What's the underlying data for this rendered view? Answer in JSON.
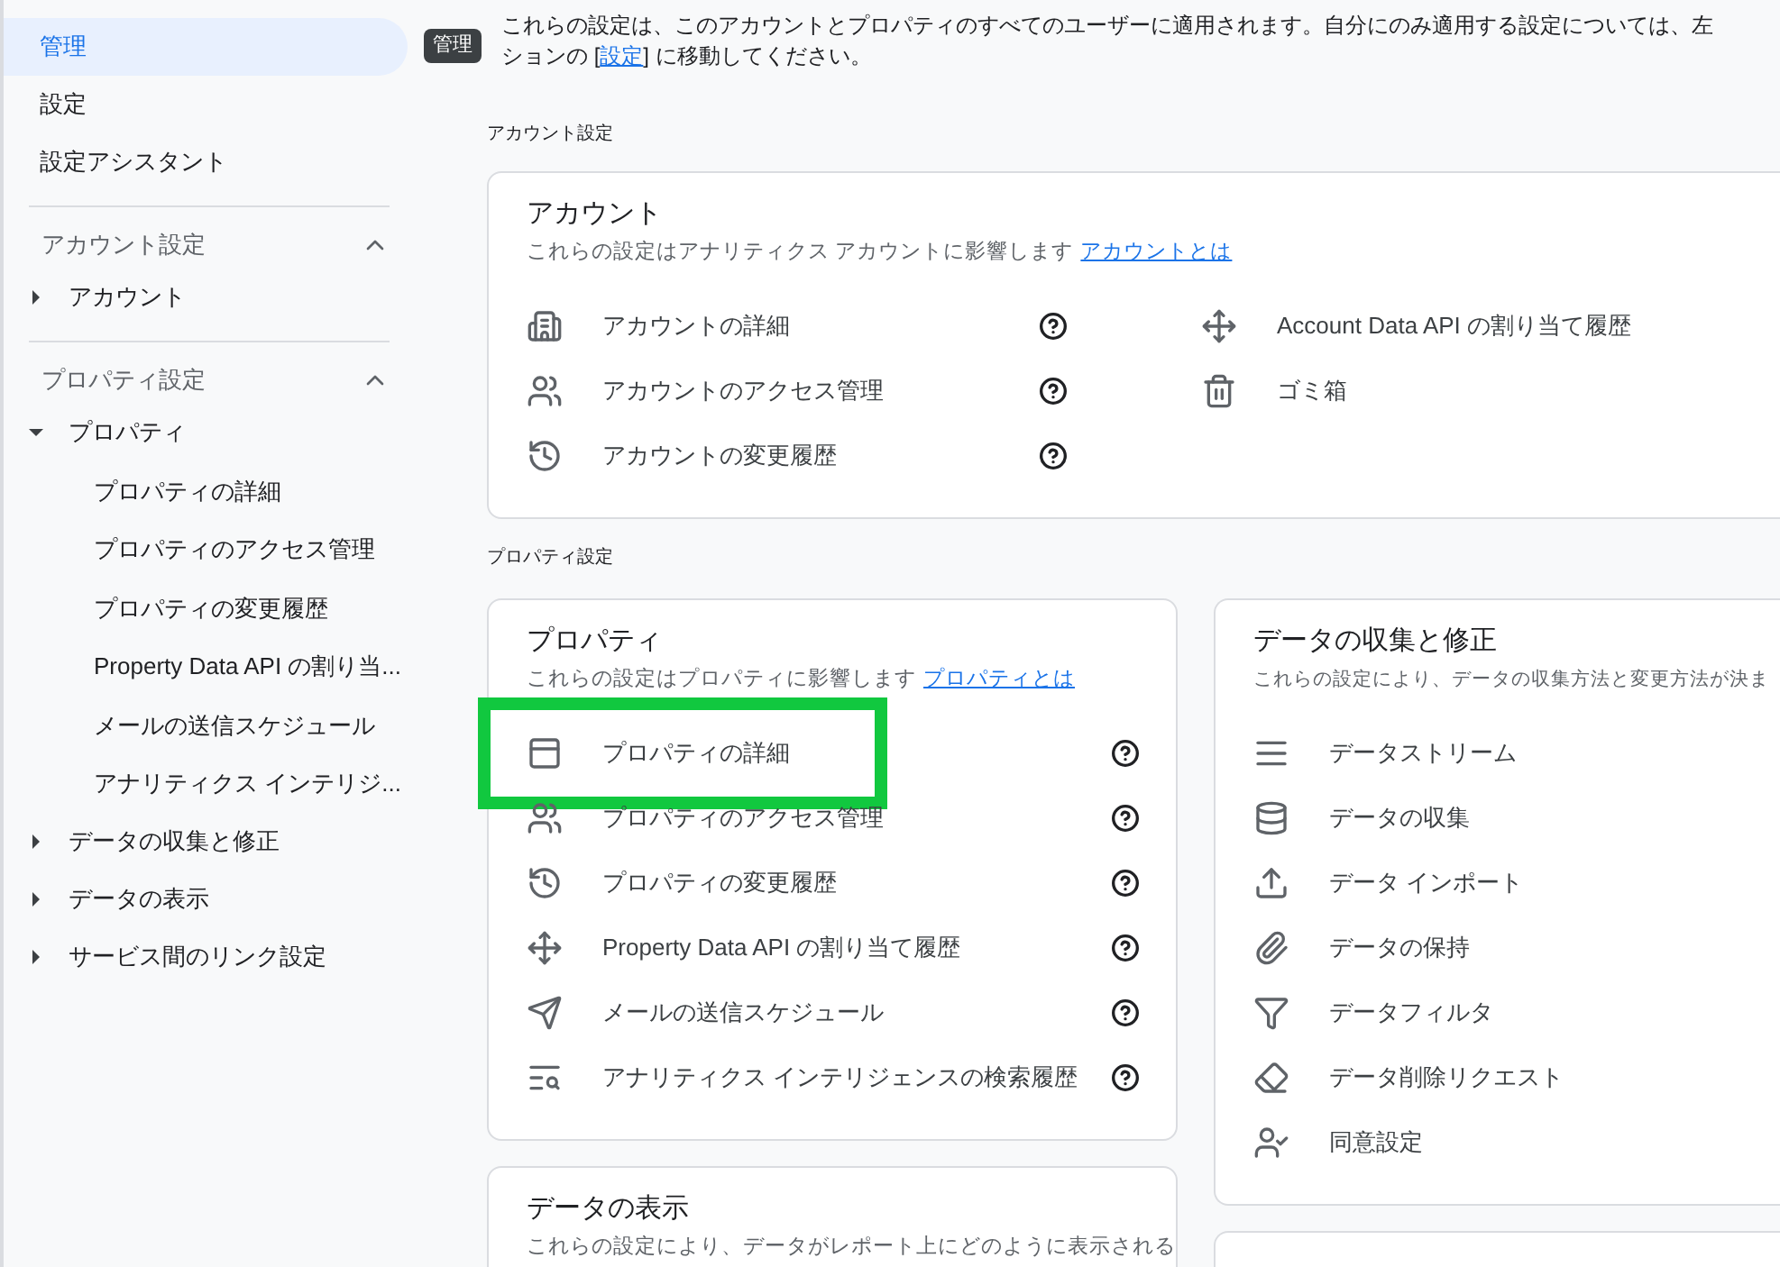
{
  "sidebar": {
    "items": [
      {
        "label": "管理",
        "selected": true,
        "tooltip": "管理"
      },
      {
        "label": "設定",
        "selected": false
      },
      {
        "label": "設定アシスタント",
        "selected": false
      }
    ],
    "sections": [
      {
        "title": "アカウント設定",
        "expanded": true,
        "items": [
          {
            "label": "アカウント",
            "expanded": false
          }
        ]
      },
      {
        "title": "プロパティ設定",
        "expanded": true,
        "items": [
          {
            "label": "プロパティ",
            "expanded": true,
            "children": [
              {
                "label": "プロパティの詳細"
              },
              {
                "label": "プロパティのアクセス管理"
              },
              {
                "label": "プロパティの変更履歴"
              },
              {
                "label": "Property Data API の割り当..."
              },
              {
                "label": "メールの送信スケジュール"
              },
              {
                "label": "アナリティクス インテリジ..."
              }
            ]
          },
          {
            "label": "データの収集と修正",
            "expanded": false
          },
          {
            "label": "データの表示",
            "expanded": false
          },
          {
            "label": "サービス間のリンク設定",
            "expanded": false
          }
        ]
      }
    ]
  },
  "notice": {
    "line_1": "これらの設定は、このアカウントとプロパティのすべてのユーザーに適用されます。自分にのみ適用する設定については、左",
    "before_link": "ションの [",
    "link": "設定",
    "after_link": "] に移動してください。"
  },
  "groups": [
    {
      "label": "アカウント設定",
      "cards": [
        {
          "title": "アカウント",
          "description": "これらの設定はアナリティクス アカウントに影響します",
          "link": "アカウントとは",
          "columns": [
            [
              {
                "label": "アカウントの詳細",
                "help": true
              },
              {
                "label": "アカウントのアクセス管理",
                "help": true
              },
              {
                "label": "アカウントの変更履歴",
                "help": true
              }
            ],
            [
              {
                "label": "Account Data API の割り当て履歴",
                "help": false
              },
              {
                "label": "ゴミ箱",
                "help": false
              }
            ]
          ]
        }
      ]
    },
    {
      "label": "プロパティ設定",
      "cards": [
        {
          "title": "プロパティ",
          "description": "これらの設定はプロパティに影響します",
          "link": "プロパティとは",
          "columns": [
            [
              {
                "label": "プロパティの詳細",
                "help": true,
                "highlighted": true
              },
              {
                "label": "プロパティのアクセス管理",
                "help": true,
                "highlighted": false
              },
              {
                "label": "プロパティの変更履歴",
                "help": true,
                "highlighted": false
              },
              {
                "label": "Property Data API の割り当て履歴",
                "help": true,
                "highlighted": false
              },
              {
                "label": "メールの送信スケジュール",
                "help": true,
                "highlighted": false
              },
              {
                "label": "アナリティクス インテリジェンスの検索履歴",
                "help": true,
                "highlighted": false
              }
            ]
          ]
        },
        {
          "title": "データの収集と修正",
          "description": "これらの設定により、データの収集方法と変更方法が決ま",
          "columns": [
            [
              {
                "label": "データストリーム",
                "help": false
              },
              {
                "label": "データの収集",
                "help": false
              },
              {
                "label": "データ インポート",
                "help": false
              },
              {
                "label": "データの保持",
                "help": false
              },
              {
                "label": "データフィルタ",
                "help": false
              },
              {
                "label": "データ削除リクエスト",
                "help": false
              },
              {
                "label": "同意設定",
                "help": false
              }
            ]
          ]
        },
        {
          "title": "データの表示",
          "description": "これらの設定により、データがレポート上にどのように表示される"
        }
      ]
    }
  ]
}
